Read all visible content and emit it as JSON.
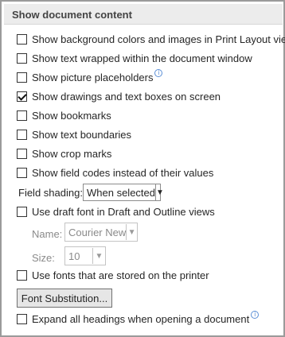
{
  "section": {
    "title": "Show document content"
  },
  "options": {
    "background_colors": {
      "label": "Show background colors and images in Print Layout view",
      "checked": false
    },
    "text_wrapped": {
      "label": "Show text wrapped within the document window",
      "checked": false
    },
    "picture_placeholders": {
      "label": "Show picture placeholders",
      "checked": false
    },
    "drawings_text_boxes": {
      "label": "Show drawings and text boxes on screen",
      "checked": true
    },
    "bookmarks": {
      "label": "Show bookmarks",
      "checked": false
    },
    "text_boundaries": {
      "label": "Show text boundaries",
      "checked": false
    },
    "crop_marks": {
      "label": "Show crop marks",
      "checked": false
    },
    "field_codes": {
      "label": "Show field codes instead of their values",
      "checked": false
    },
    "draft_font": {
      "label": "Use draft font in Draft and Outline views",
      "checked": false
    },
    "printer_fonts": {
      "label": "Use fonts that are stored on the printer",
      "checked": false
    },
    "expand_headings": {
      "label": "Expand all headings when opening a document",
      "checked": false
    }
  },
  "field_shading": {
    "label": "Field shading:",
    "value": "When selected"
  },
  "font_name": {
    "label": "Name:",
    "value": "Courier New"
  },
  "font_size": {
    "label": "Size:",
    "value": "10"
  },
  "font_substitution": {
    "label": "Font Substitution..."
  },
  "icons": {
    "info": "info-icon",
    "dropdown": "chevron-down-icon",
    "check": "checkmark-icon"
  }
}
